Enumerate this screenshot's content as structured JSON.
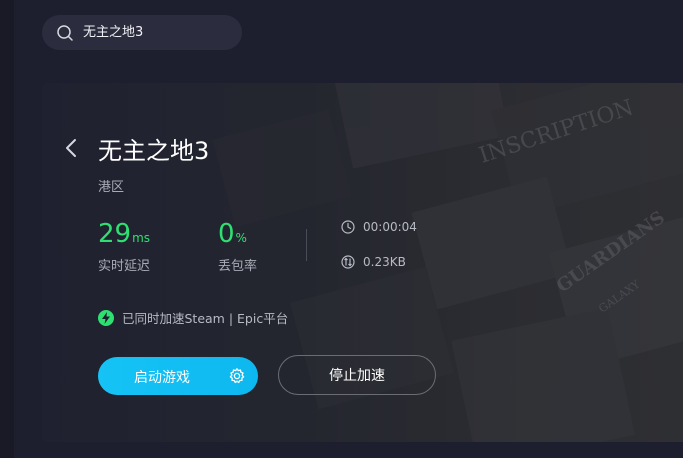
{
  "search": {
    "value": "无主之地3",
    "icon": "search-icon"
  },
  "game": {
    "title": "无主之地3",
    "region": "港区"
  },
  "stats": {
    "latency": {
      "value": "29",
      "unit": "ms",
      "label": "实时延迟"
    },
    "packet_loss": {
      "value": "0",
      "unit": "%",
      "label": "丢包率"
    },
    "duration": "00:00:04",
    "traffic": "0.23KB"
  },
  "notice": "已同时加速Steam | Epic平台",
  "buttons": {
    "start": "启动游戏",
    "stop": "停止加速"
  },
  "background_art": {
    "texts": [
      "INSCRIPTION",
      "GUARDIANS",
      "GALAXY"
    ]
  },
  "colors": {
    "accent_green": "#2ee071",
    "accent_blue": "#16c3f5",
    "background": "#1e1f2e"
  }
}
